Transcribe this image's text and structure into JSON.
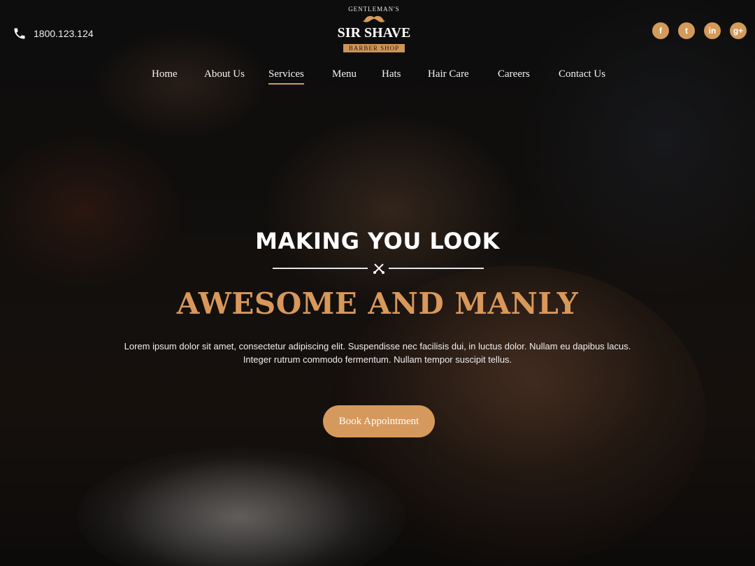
{
  "header": {
    "phone": "1800.123.124",
    "logo": {
      "tagline": "GENTLEMAN'S",
      "name": "SIR SHAVE",
      "subtitle": "BARBER SHOP"
    },
    "social": [
      {
        "icon": "facebook-icon",
        "glyph": "f"
      },
      {
        "icon": "twitter-icon",
        "glyph": "t"
      },
      {
        "icon": "linkedin-icon",
        "glyph": "in"
      },
      {
        "icon": "google-plus-icon",
        "glyph": "g+"
      }
    ]
  },
  "nav": {
    "items": [
      {
        "label": "Home"
      },
      {
        "label": "About Us"
      },
      {
        "label": "Services",
        "active": true
      },
      {
        "label": "Menu"
      },
      {
        "label": "Hats"
      },
      {
        "label": "Hair Care"
      },
      {
        "label": "Careers"
      },
      {
        "label": "Contact Us"
      }
    ]
  },
  "hero": {
    "heading": "MAKING YOU LOOK",
    "subheading": "AWESOME AND MANLY",
    "description_line1": "Lorem ipsum dolor sit amet, consectetur adipiscing elit. Suspendisse nec facilisis dui, in luctus dolor. Nullam eu dapibus lacus.",
    "description_line2": "Integer rutrum commodo fermentum. Nullam tempor suscipit tellus.",
    "cta_label": "Book Appointment"
  },
  "colors": {
    "accent": "#d6995d",
    "text": "#ffffff",
    "background": "#0c0a09"
  }
}
